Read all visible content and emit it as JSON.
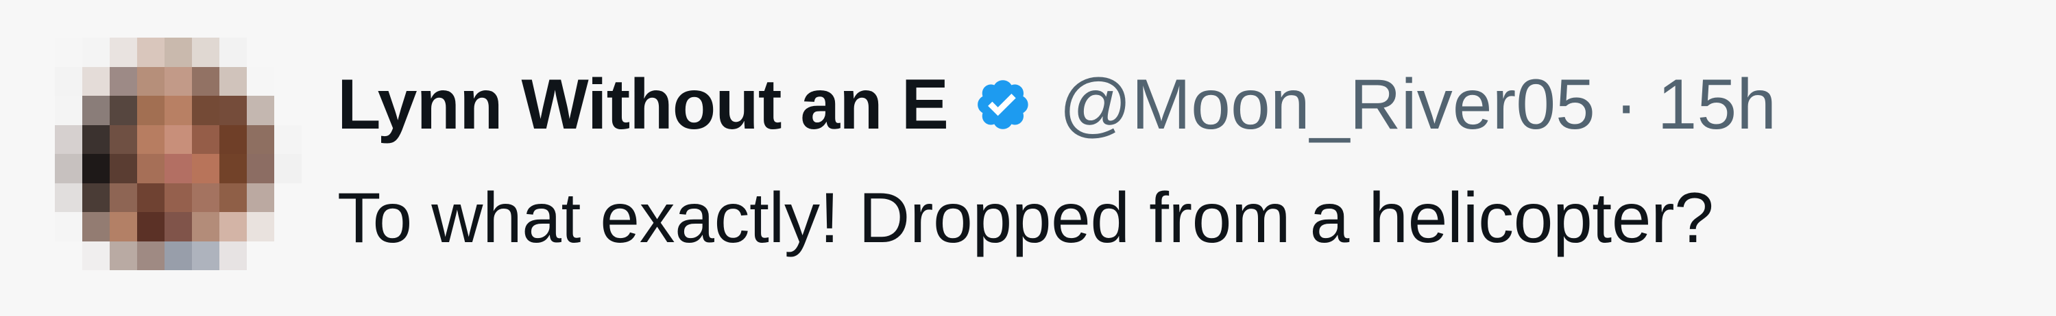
{
  "tweet": {
    "display_name": "Lynn Without an E",
    "handle": "@Moon_River05",
    "separator": "·",
    "time": "15h",
    "text": "To what exactly! Dropped from a helicopter?",
    "verified": true
  },
  "icons": {
    "verified_badge": "verified-check-icon",
    "avatar": "pixelated-avatar"
  },
  "colors": {
    "background": "#f7f7f7",
    "name": "#0f1419",
    "meta": "#536471",
    "verified": "#1d9bf0"
  }
}
